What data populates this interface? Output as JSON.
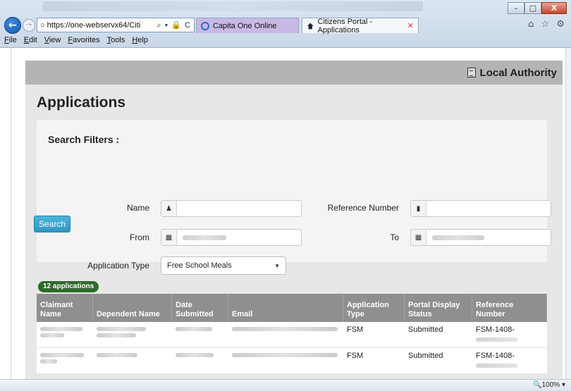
{
  "browser": {
    "address_url": "https://one-webservx64/Citi",
    "address_tools": "⌕ ▾ 🔒 C",
    "tabs": [
      {
        "label": "Capita One Online",
        "active": false
      },
      {
        "label": "Citizens Portal - Applications",
        "active": true
      }
    ],
    "window_buttons": [
      "–",
      "□",
      "X"
    ],
    "right_icons": "⌂ ☆ ⚙",
    "menu": [
      "File",
      "Edit",
      "View",
      "Favorites",
      "Tools",
      "Help"
    ],
    "zoom_level": "🔍100%  ▾"
  },
  "header": {
    "authority_label": "Local Authority"
  },
  "page": {
    "title": "Applications"
  },
  "filters": {
    "title": "Search Filters :",
    "name_label": "Name",
    "reference_label": "Reference Number",
    "from_label": "From",
    "to_label": "To",
    "application_type_label": "Application Type",
    "application_type_value": "Free School Meals",
    "search_button": "Search"
  },
  "results": {
    "count_badge": "12 applications",
    "columns": [
      "Claimant Name",
      "Dependent Name",
      "Date Submitted",
      "Email",
      "Application Type",
      "Portal Display Status",
      "Reference Number"
    ],
    "rows": [
      {
        "type": "FSM",
        "status": "Submitted",
        "reference": "FSM-1408-"
      },
      {
        "type": "FSM",
        "status": "Submitted",
        "reference": "FSM-1408-"
      }
    ]
  },
  "colors": {
    "search_button": "#3aa3cf",
    "badge": "#2d6b2a",
    "table_header": "#8f8f8f",
    "topbar": "#b4b4b4"
  }
}
